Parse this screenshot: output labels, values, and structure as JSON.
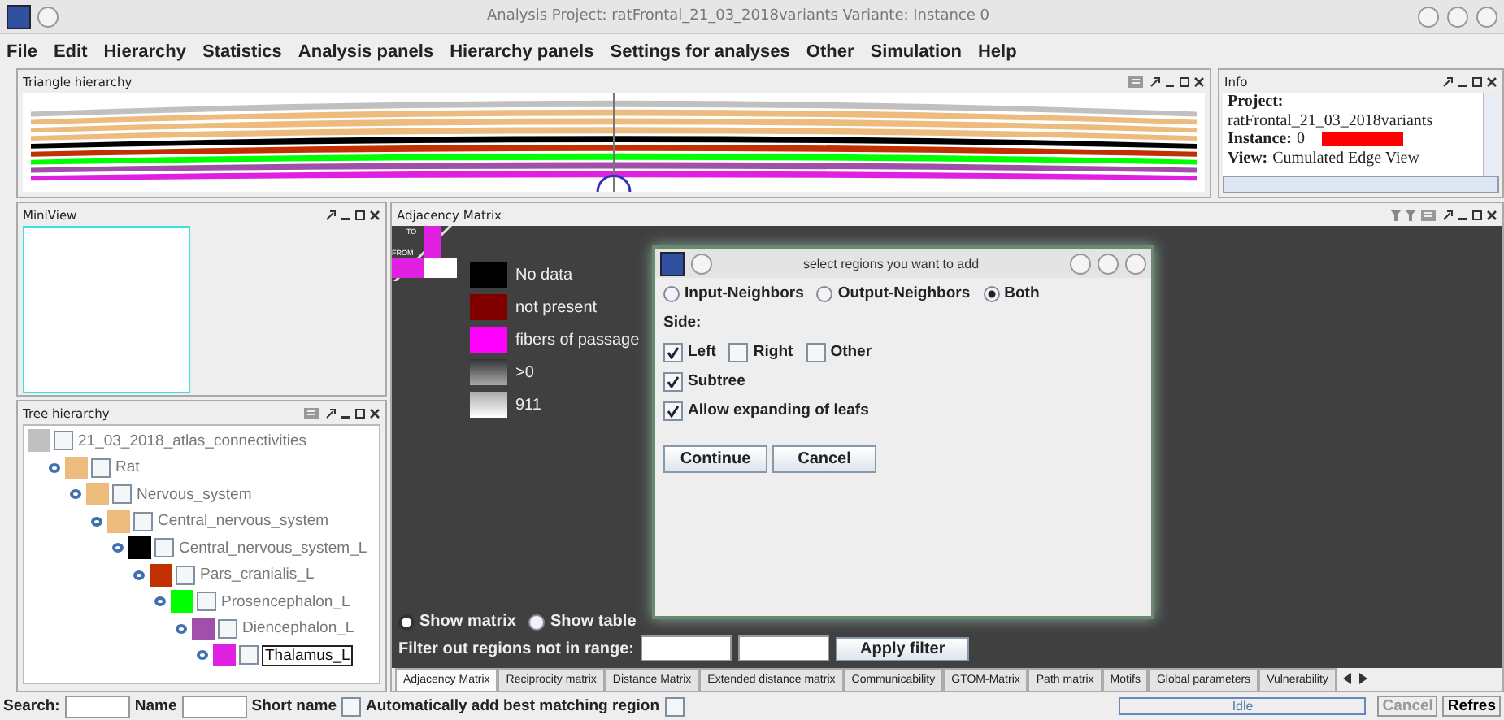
{
  "window": {
    "title": "Analysis  Project: ratFrontal_21_03_2018variants  Variante:  Instance 0"
  },
  "menu": [
    "File",
    "Edit",
    "Hierarchy",
    "Statistics",
    "Analysis panels",
    "Hierarchy panels",
    "Settings for analyses",
    "Other",
    "Simulation",
    "Help"
  ],
  "triangle_panel": {
    "title": "Triangle hierarchy"
  },
  "info_panel": {
    "title": "Info",
    "lines": [
      {
        "label": "Project:"
      },
      {
        "value": "ratFrontal_21_03_2018variants"
      },
      {
        "label": "Instance:",
        "value": "0"
      },
      {
        "label": "View:",
        "value": "Cumulated Edge View"
      }
    ]
  },
  "miniview": {
    "title": "MiniView"
  },
  "tree_panel": {
    "title": "Tree hierarchy",
    "root": {
      "name": "21_03_2018_atlas_connectivities",
      "color": "#c0c0c0",
      "checked": false,
      "selected": false,
      "children": [
        {
          "name": "Rat",
          "color": "#eebb7f",
          "checked": false,
          "selected": false,
          "children": [
            {
              "name": "Nervous_system",
              "color": "#eebb7f",
              "checked": false,
              "selected": false,
              "children": [
                {
                  "name": "Central_nervous_system",
                  "color": "#eebb7f",
                  "checked": false,
                  "selected": false,
                  "children": [
                    {
                      "name": "Central_nervous_system_L",
                      "color": "#000000",
                      "checked": false,
                      "selected": false,
                      "children": [
                        {
                          "name": "Pars_cranialis_L",
                          "color": "#c03000",
                          "checked": false,
                          "selected": false,
                          "children": [
                            {
                              "name": "Prosencephalon_L",
                              "color": "#00ff00",
                              "checked": false,
                              "selected": false,
                              "children": [
                                {
                                  "name": "Diencephalon_L",
                                  "color": "#a050a8",
                                  "checked": false,
                                  "selected": false,
                                  "children": [
                                    {
                                      "name": "Thalamus_L",
                                      "color": "#e020e0",
                                      "checked": false,
                                      "selected": true
                                    }
                                  ]
                                }
                              ]
                            }
                          ]
                        }
                      ]
                    }
                  ]
                }
              ]
            }
          ]
        }
      ]
    }
  },
  "matrix_panel": {
    "title": "Adjacency Matrix",
    "corner": {
      "to": "TO",
      "from": "FROM"
    },
    "legend": [
      {
        "label": "No data",
        "kind": "swatch",
        "color": "#000000"
      },
      {
        "label": "not present",
        "kind": "swatch",
        "color": "#800000"
      },
      {
        "label": "fibers of passage",
        "kind": "swatch",
        "color": "#ff00ff"
      },
      {
        "label": ">0",
        "kind": "gradient"
      },
      {
        "label": "911",
        "kind": "gradient-end"
      }
    ],
    "view_options": [
      {
        "label": "Show matrix",
        "selected": true
      },
      {
        "label": "Show table",
        "selected": false
      }
    ],
    "filter": {
      "label": "Filter out regions not in range:",
      "button": "Apply filter"
    },
    "tabs": [
      {
        "label": "Adjacency Matrix",
        "selected": true
      },
      {
        "label": "Reciprocity matrix",
        "selected": false
      },
      {
        "label": "Distance Matrix",
        "selected": false
      },
      {
        "label": "Extended distance matrix",
        "selected": false
      },
      {
        "label": "Communicability",
        "selected": false
      },
      {
        "label": "GTOM-Matrix",
        "selected": false
      },
      {
        "label": "Path matrix",
        "selected": false
      },
      {
        "label": "Motifs",
        "selected": false
      },
      {
        "label": "Global parameters",
        "selected": false
      },
      {
        "label": "Vulnerability",
        "selected": false
      }
    ]
  },
  "dialog": {
    "title": "select regions you want to add",
    "neighbors": [
      {
        "label": "Input-Neighbors",
        "selected": false
      },
      {
        "label": "Output-Neighbors",
        "selected": false
      },
      {
        "label": "Both",
        "selected": true
      }
    ],
    "side_label": "Side:",
    "sides": [
      {
        "label": "Left",
        "checked": true
      },
      {
        "label": "Right",
        "checked": false
      },
      {
        "label": "Other",
        "checked": false
      }
    ],
    "options": [
      {
        "label": "Subtree",
        "checked": true
      },
      {
        "label": "Allow expanding of leafs",
        "checked": true
      }
    ],
    "buttons": [
      "Continue",
      "Cancel"
    ]
  },
  "status_bar": {
    "search_label": "Search:",
    "name_label": "Name",
    "short_name": {
      "label": "Short name",
      "checked": false
    },
    "auto_add": {
      "label": "Automatically add best matching region",
      "checked": false
    },
    "status": "Idle",
    "cancel": "Cancel",
    "refresh": "Refres"
  }
}
